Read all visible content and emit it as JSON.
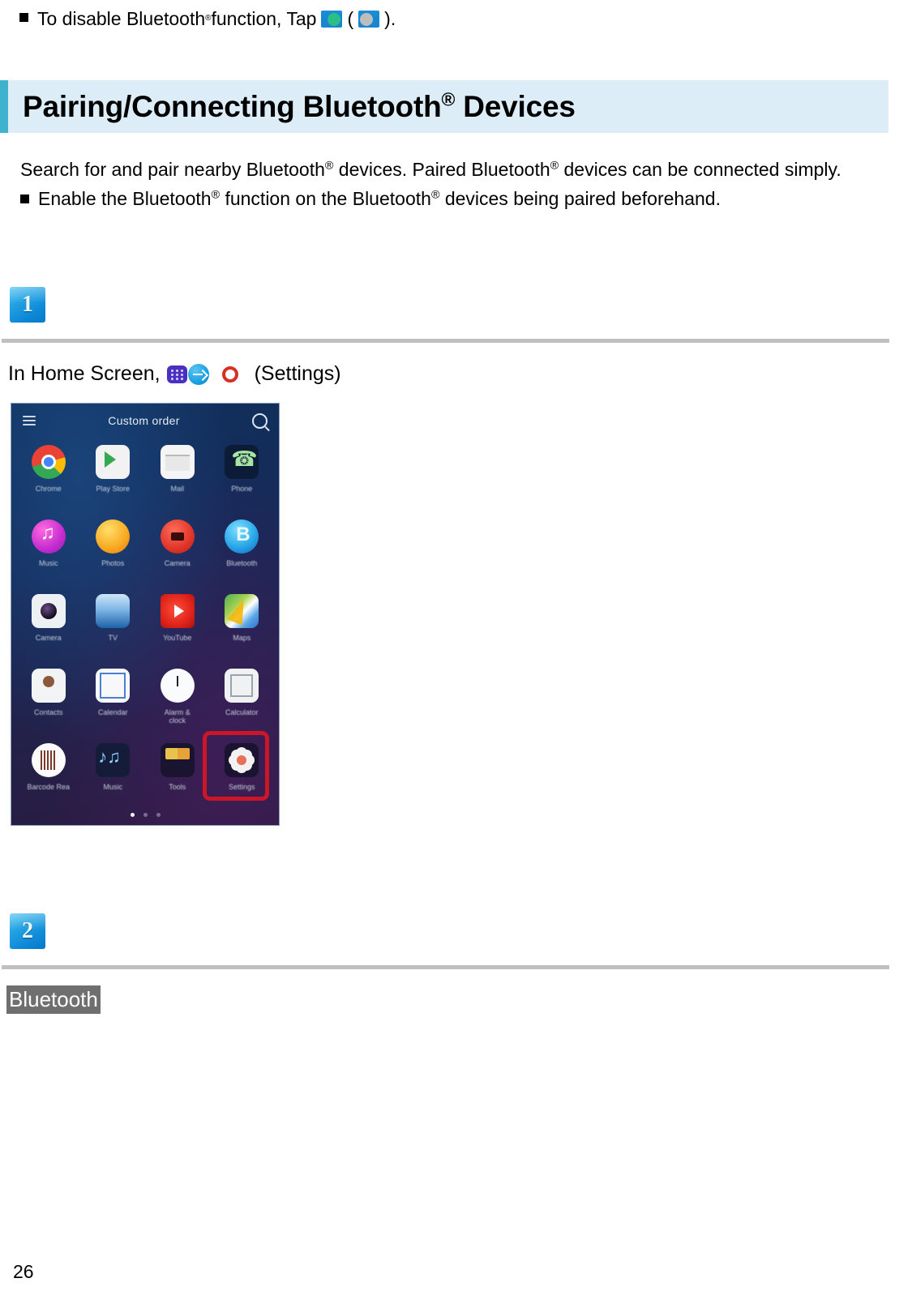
{
  "top_note": {
    "bullet_text_before": "To disable Bluetooth",
    "reg_mark": "®",
    "bullet_text_middle": " function, Tap ",
    "icon_on": "toggle-on-icon",
    "paren_open": "(",
    "icon_off": "toggle-off-icon",
    "paren_close": ").",
    "full_text": "To disable Bluetooth® function, Tap  ( )."
  },
  "section": {
    "title_before": "Pairing/Connecting Bluetooth",
    "title_reg": "®",
    "title_after": " Devices",
    "accent_color": "#3fb3cd",
    "background_color": "#dcedf8"
  },
  "intro": {
    "paragraph_part1": "Search for and pair nearby Bluetooth",
    "paragraph_reg1": "®",
    "paragraph_part2": " devices. Paired Bluetooth",
    "paragraph_reg2": "®",
    "paragraph_part3": " devices can be connected simply.",
    "bullet_part1": "Enable the Bluetooth",
    "bullet_reg1": "®",
    "bullet_part2": " function on the Bluetooth",
    "bullet_reg2": "®",
    "bullet_part3": " devices being paired beforehand."
  },
  "steps": [
    {
      "number": "1",
      "instruction_prefix": "In Home Screen, ",
      "icons": [
        "app-drawer-icon",
        "arrow-right-icon",
        "settings-gear-icon"
      ],
      "instruction_suffix": "(Settings)"
    },
    {
      "number": "2",
      "keyword": "Bluetooth"
    }
  ],
  "phone_screenshot": {
    "drawer_title": "Custom order",
    "menu_icon": "hamburger-menu-icon",
    "search_icon": "search-icon",
    "apps": [
      {
        "label": "Chrome",
        "icon": "chrome-icon"
      },
      {
        "label": "Play Store",
        "icon": "play-store-icon"
      },
      {
        "label": "Mail",
        "icon": "mail-icon"
      },
      {
        "label": "Phone",
        "icon": "phone-icon"
      },
      {
        "label": "Music",
        "icon": "music-icon"
      },
      {
        "label": "Photos",
        "icon": "photos-icon"
      },
      {
        "label": "Camera",
        "icon": "camera-red-icon"
      },
      {
        "label": "Bluetooth",
        "icon": "bluetooth-blue-icon"
      },
      {
        "label": "Camera",
        "icon": "camera-icon"
      },
      {
        "label": "TV",
        "icon": "tv-icon"
      },
      {
        "label": "YouTube",
        "icon": "youtube-icon"
      },
      {
        "label": "Maps",
        "icon": "maps-icon"
      },
      {
        "label": "Contacts",
        "icon": "contacts-icon"
      },
      {
        "label": "Calendar",
        "icon": "calendar-icon"
      },
      {
        "label": "Alarm &\nclock",
        "icon": "clock-icon"
      },
      {
        "label": "Calculator",
        "icon": "calculator-icon"
      },
      {
        "label": "Barcode Rea",
        "icon": "barcode-icon"
      },
      {
        "label": "Music",
        "icon": "music-note-icon"
      },
      {
        "label": "Tools",
        "icon": "tools-icon"
      },
      {
        "label": "Settings",
        "icon": "settings-icon"
      }
    ],
    "highlight_target": "Settings",
    "highlight_color": "#cc1628",
    "page_dots": 3,
    "active_dot_index": 0
  },
  "footer": {
    "page_number": "26"
  }
}
